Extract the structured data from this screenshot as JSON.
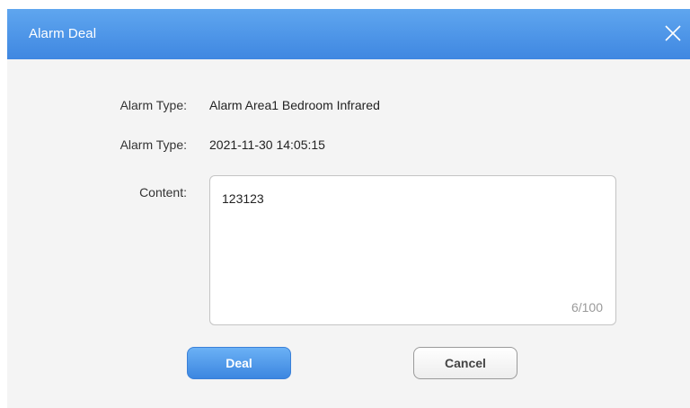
{
  "dialog": {
    "title": "Alarm Deal",
    "close_icon": "close-icon"
  },
  "fields": {
    "alarm_type_label": "Alarm Type:",
    "alarm_type_value": "Alarm Area1 Bedroom Infrared",
    "alarm_time_label": "Alarm Type:",
    "alarm_time_value": "2021-11-30 14:05:15",
    "content_label": "Content:",
    "content_value": "123123",
    "content_counter": "6/100"
  },
  "buttons": {
    "deal_label": "Deal",
    "cancel_label": "Cancel"
  },
  "colors": {
    "titlebar": "#4a93e6",
    "primary_button": "#4a93e6"
  }
}
